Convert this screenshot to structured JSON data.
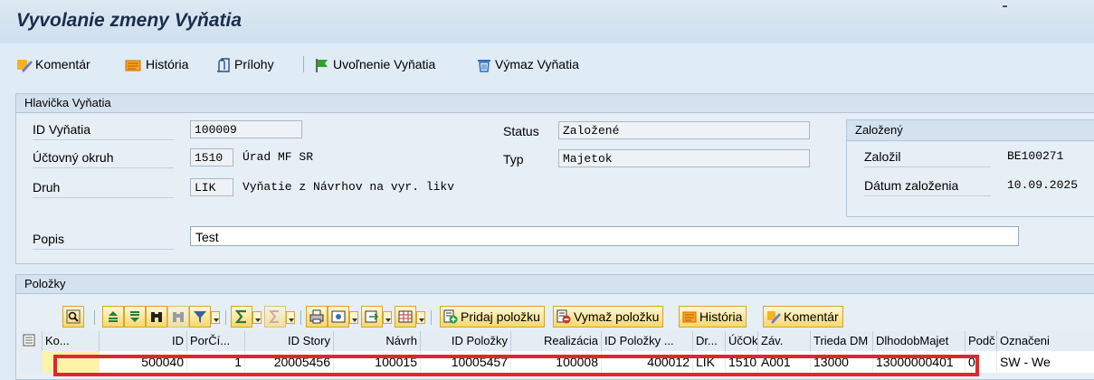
{
  "window": {
    "title": "Vyvolanie zmeny Vyňatia"
  },
  "toolbar": {
    "komentar": "Komentár",
    "historia": "História",
    "prilohy": "Prílohy",
    "uvolnenie": "Uvoľnenie Vyňatia",
    "vymaz": "Výmaz Vyňatia"
  },
  "header": {
    "title": "Hlavička Vyňatia",
    "id_label": "ID Vyňatia",
    "id_value": "100009",
    "okruh_label": "Účtovný okruh",
    "okruh_value": "1510",
    "okruh_text": "Úrad MF SR",
    "druh_label": "Druh",
    "druh_value": "LIK",
    "druh_text": "Vyňatie z Návrhov na vyr. likv",
    "status_label": "Status",
    "status_value": "Založené",
    "typ_label": "Typ",
    "typ_value": "Majetok",
    "popis_label": "Popis",
    "popis_value": "Test"
  },
  "created": {
    "title": "Založený",
    "by_label": "Založil",
    "by_value": "BE100271",
    "date_label": "Dátum založenia",
    "date_value": "10.09.2025"
  },
  "items": {
    "title": "Položky",
    "add_item": "Pridaj položku",
    "delete_item": "Vymaž položku",
    "history": "História",
    "comment": "Komentár",
    "columns": [
      "Ko...",
      "ID",
      "PorČí...",
      "ID Story",
      "Návrh",
      "ID Položky",
      "Realizácia",
      "ID Položky ...",
      "Dr...",
      "ÚčOk",
      "Záv.",
      "Trieda DM",
      "DlhodobMajet",
      "Podč",
      "Označeni"
    ],
    "rows": [
      [
        "",
        "500040",
        "1",
        "20005456",
        "100015",
        "10005457",
        "100008",
        "400012",
        "LIK",
        "1510",
        "A001",
        "13000",
        "13000000401",
        "0",
        "SW - We"
      ]
    ]
  },
  "colors": {
    "highlight_box": "#e1262d",
    "title_text": "#1a2e4c",
    "button_bg": "#f8d86a"
  }
}
